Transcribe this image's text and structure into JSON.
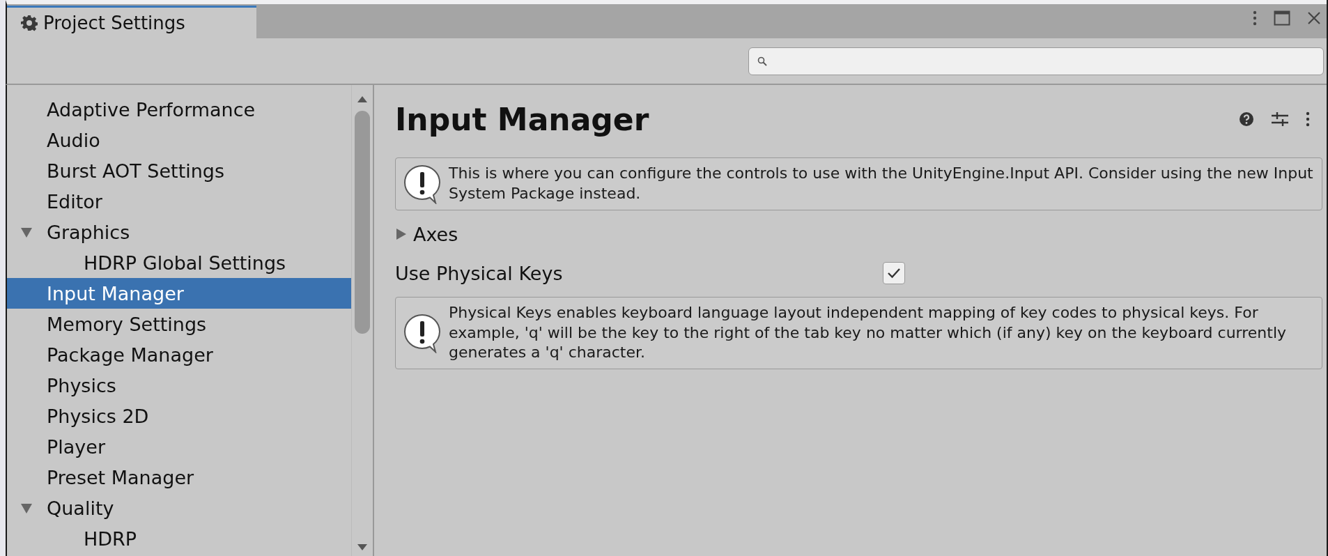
{
  "window": {
    "tab_title": "Project Settings"
  },
  "sidebar": {
    "items": [
      {
        "label": "Adaptive Performance",
        "selected": false
      },
      {
        "label": "Audio",
        "selected": false
      },
      {
        "label": "Burst AOT Settings",
        "selected": false
      },
      {
        "label": "Editor",
        "selected": false
      },
      {
        "label": "Graphics",
        "selected": false,
        "expanded": true,
        "children": [
          {
            "label": "HDRP Global Settings",
            "selected": false
          }
        ]
      },
      {
        "label": "Input Manager",
        "selected": true
      },
      {
        "label": "Memory Settings",
        "selected": false
      },
      {
        "label": "Package Manager",
        "selected": false
      },
      {
        "label": "Physics",
        "selected": false
      },
      {
        "label": "Physics 2D",
        "selected": false
      },
      {
        "label": "Player",
        "selected": false
      },
      {
        "label": "Preset Manager",
        "selected": false
      },
      {
        "label": "Quality",
        "selected": false,
        "expanded": true,
        "children": [
          {
            "label": "HDRP",
            "selected": false
          }
        ]
      }
    ]
  },
  "content": {
    "title": "Input Manager",
    "items": [
      {
        "kind": "info",
        "text": "This is where you can configure the controls to use with the UnityEngine.Input API. Consider using the new Input System Package instead."
      },
      {
        "kind": "foldout",
        "label": "Axes",
        "expanded": false
      },
      {
        "kind": "toggle",
        "label": "Use Physical Keys",
        "checked": true
      },
      {
        "kind": "info",
        "text": "Physical Keys enables keyboard language layout independent mapping of key codes to physical keys. For example, 'q' will be the key to the right of the tab key no matter which (if any) key on the keyboard currently generates a 'q' character."
      }
    ]
  }
}
